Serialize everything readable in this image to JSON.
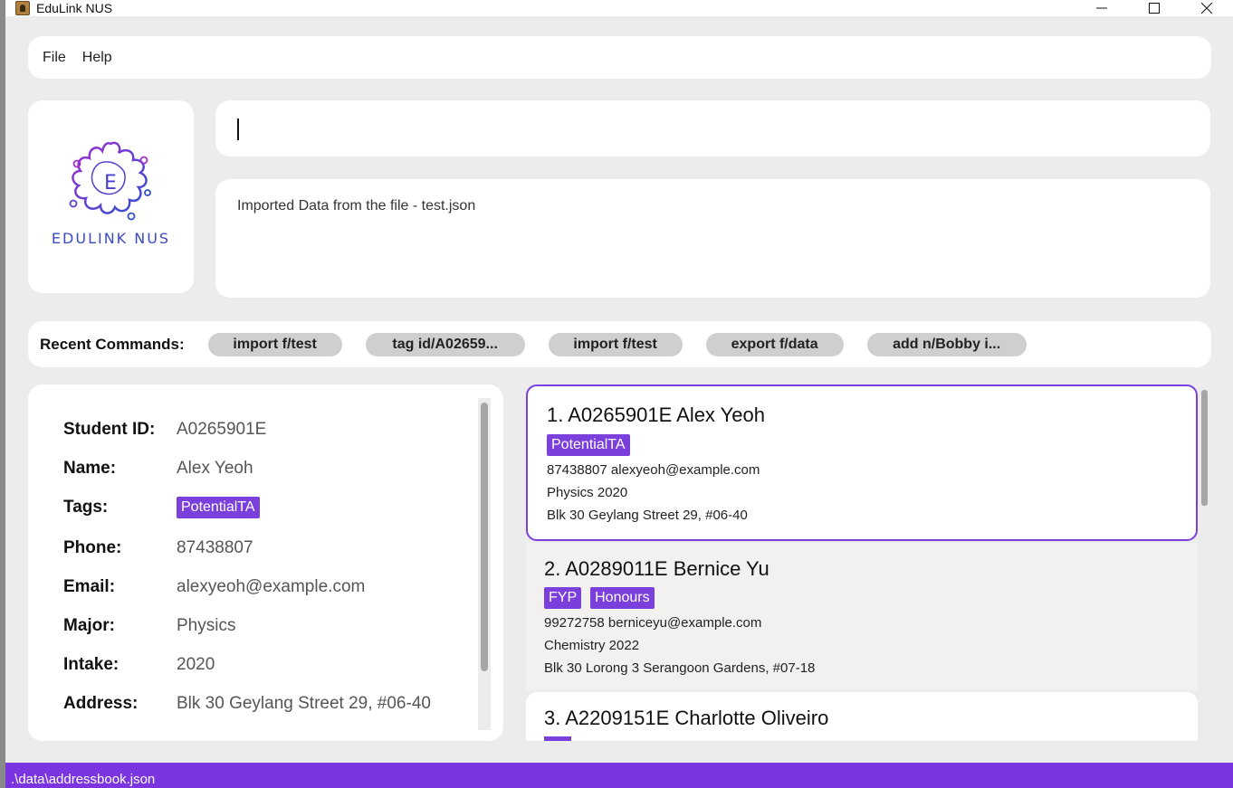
{
  "window": {
    "title": "EduLink NUS"
  },
  "menu": {
    "items": [
      "File",
      "Help"
    ]
  },
  "logo": {
    "text": "EDULINK NUS",
    "letter": "E"
  },
  "command": {
    "value": "",
    "placeholder": ""
  },
  "result": {
    "text": "Imported Data from the file - test.json"
  },
  "recent": {
    "label": "Recent Commands:",
    "chips": [
      "import f/test",
      "tag id/A02659...",
      "import f/test",
      "export f/data",
      "add n/Bobby i..."
    ]
  },
  "detail": {
    "rows": [
      {
        "label": "Student ID:",
        "value": "A0265901E"
      },
      {
        "label": "Name:",
        "value": "Alex Yeoh"
      },
      {
        "label": "Tags:",
        "value": "PotentialTA"
      },
      {
        "label": "Phone:",
        "value": "87438807"
      },
      {
        "label": "Email:",
        "value": "alexyeoh@example.com"
      },
      {
        "label": "Major:",
        "value": "Physics"
      },
      {
        "label": "Intake:",
        "value": "2020"
      },
      {
        "label": "Address:",
        "value": "Blk 30 Geylang Street 29, #06-40"
      }
    ]
  },
  "students": [
    {
      "title": "1.  A0265901E Alex Yeoh",
      "tags": [
        "PotentialTA"
      ],
      "contact": "87438807  alexyeoh@example.com",
      "major_intake": "Physics  2020",
      "address": "Blk 30 Geylang Street 29, #06-40"
    },
    {
      "title": "2.  A0289011E Bernice Yu",
      "tags": [
        "FYP",
        "Honours"
      ],
      "contact": "99272758  berniceyu@example.com",
      "major_intake": "Chemistry  2022",
      "address": "Blk 30 Lorong 3 Serangoon Gardens, #07-18"
    },
    {
      "title": "3.  A2209151E Charlotte Oliveiro"
    }
  ],
  "status": {
    "path": ".\\data\\addressbook.json"
  },
  "colors": {
    "accent": "#7b3fdc",
    "statusbar": "#7b35e0",
    "logo": "#3b4cc0"
  }
}
